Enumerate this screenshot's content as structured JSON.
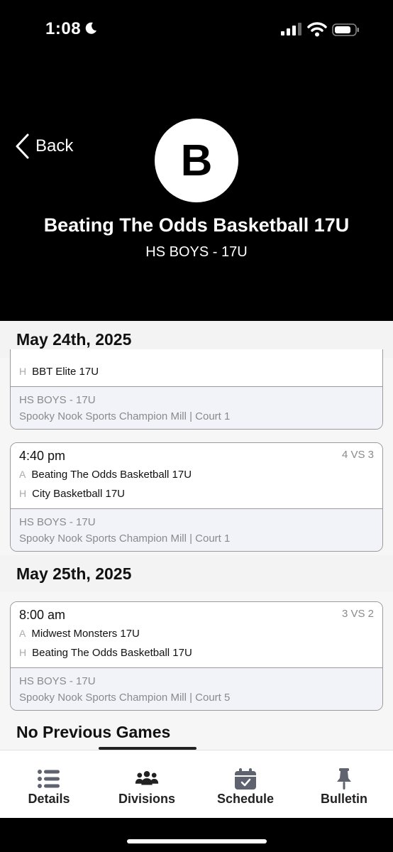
{
  "status_bar": {
    "time": "1:08"
  },
  "header": {
    "back_label": "Back",
    "avatar_letter": "B",
    "team_name": "Beating The Odds Basketball 17U",
    "division": "HS BOYS - 17U"
  },
  "schedule": {
    "dates": [
      "May 24th, 2025",
      "May 25th, 2025"
    ],
    "games": [
      {
        "home_marker": "H",
        "home_team": "BBT Elite 17U",
        "division": "HS BOYS - 17U",
        "location": "Spooky Nook Sports Champion Mill  |  Court 1"
      },
      {
        "time": "4:40 pm",
        "seed": "4 VS 3",
        "away_marker": "A",
        "away_team": "Beating The Odds Basketball 17U",
        "home_marker": "H",
        "home_team": "City Basketball 17U",
        "division": "HS BOYS - 17U",
        "location": "Spooky Nook Sports Champion Mill  |  Court 1"
      },
      {
        "time": "8:00 am",
        "seed": "3 VS 2",
        "away_marker": "A",
        "away_team": "Midwest Monsters 17U",
        "home_marker": "H",
        "home_team": "Beating The Odds Basketball 17U",
        "division": "HS BOYS - 17U",
        "location": "Spooky Nook Sports Champion Mill  |  Court 5"
      }
    ],
    "no_previous": "No Previous Games"
  },
  "tabbar": {
    "tabs": [
      {
        "label": "Details",
        "icon": "list-icon"
      },
      {
        "label": "Divisions",
        "icon": "group-icon"
      },
      {
        "label": "Schedule",
        "icon": "calendar-icon"
      },
      {
        "label": "Bulletin",
        "icon": "pin-icon"
      }
    ]
  },
  "colors": {
    "header_bg": "#000000",
    "tab_icon": "#5f6370",
    "muted_text": "#8a8a8a",
    "card_footer_bg": "#f2f3f9"
  }
}
